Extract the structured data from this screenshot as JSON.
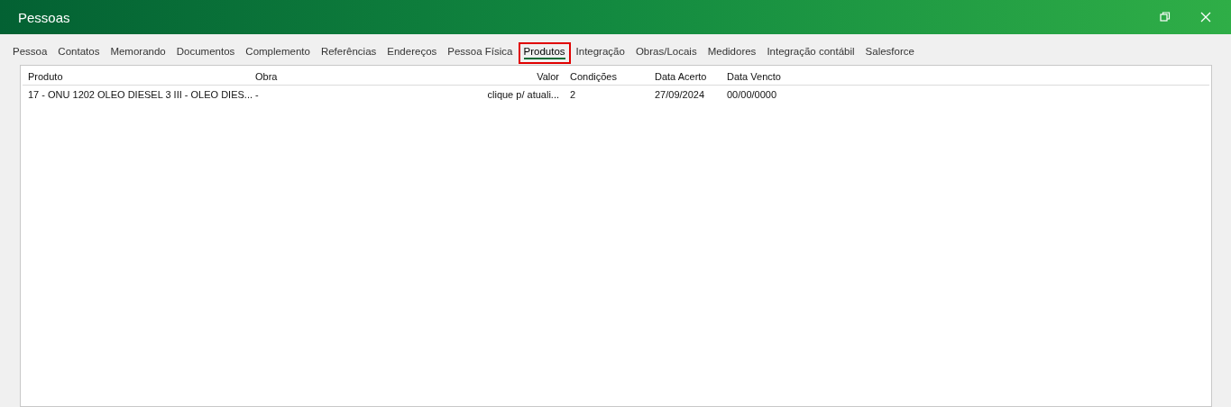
{
  "window": {
    "title": "Pessoas"
  },
  "tabs": [
    {
      "label": "Pessoa",
      "selected": false,
      "highlighted": false
    },
    {
      "label": "Contatos",
      "selected": false,
      "highlighted": false
    },
    {
      "label": "Memorando",
      "selected": false,
      "highlighted": false
    },
    {
      "label": "Documentos",
      "selected": false,
      "highlighted": false
    },
    {
      "label": "Complemento",
      "selected": false,
      "highlighted": false
    },
    {
      "label": "Referências",
      "selected": false,
      "highlighted": false
    },
    {
      "label": "Endereços",
      "selected": false,
      "highlighted": false
    },
    {
      "label": "Pessoa Física",
      "selected": false,
      "highlighted": false
    },
    {
      "label": "Produtos",
      "selected": true,
      "highlighted": true
    },
    {
      "label": "Integração",
      "selected": false,
      "highlighted": false
    },
    {
      "label": "Obras/Locais",
      "selected": false,
      "highlighted": false
    },
    {
      "label": "Medidores",
      "selected": false,
      "highlighted": false
    },
    {
      "label": "Integração contábil",
      "selected": false,
      "highlighted": false
    },
    {
      "label": "Salesforce",
      "selected": false,
      "highlighted": false
    }
  ],
  "table": {
    "columns": [
      "Produto",
      "Obra",
      "Valor",
      "Condições",
      "Data Acerto",
      "Data Vencto"
    ],
    "rows": [
      [
        "17 - ONU 1202 OLEO DIESEL 3 III - OLEO DIES...",
        "-",
        "clique p/ atuali...",
        "2",
        "27/09/2024",
        "00/00/0000"
      ]
    ]
  }
}
